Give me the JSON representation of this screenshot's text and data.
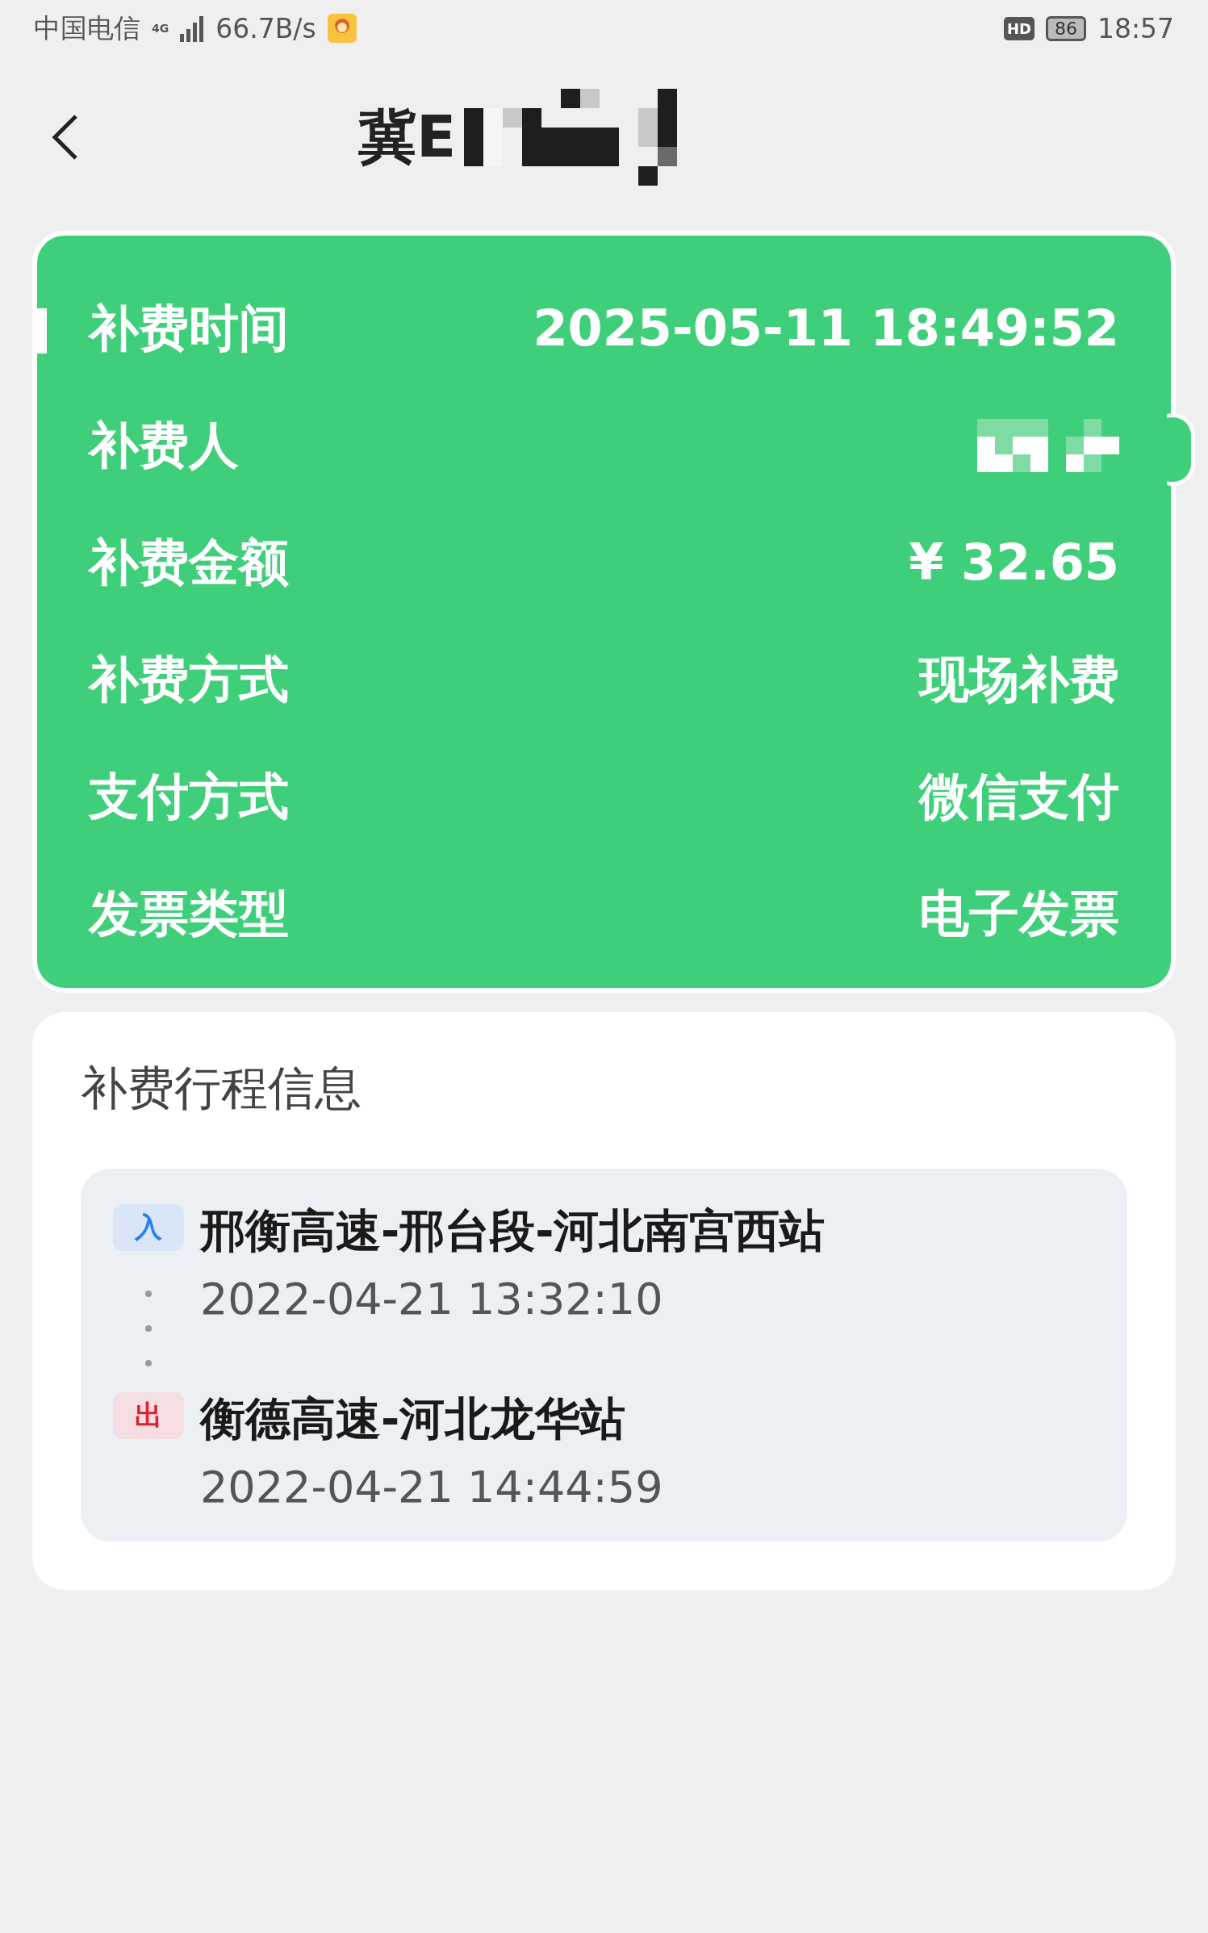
{
  "status_bar": {
    "carrier": "中国电信",
    "network": "4G",
    "speed": "66.7B/s",
    "hd": "HD",
    "battery": "86",
    "time": "18:57"
  },
  "header": {
    "title": "冀E",
    "title_redacted": true
  },
  "details": [
    {
      "label": "补费时间",
      "kind": "text",
      "value": "2025-05-11 18:49:52",
      "selected": true
    },
    {
      "label": "补费人",
      "kind": "redacted",
      "selected": false
    },
    {
      "label": "补费金额",
      "kind": "text",
      "value": "¥ 32.65",
      "selected": false
    },
    {
      "label": "补费方式",
      "kind": "text",
      "value": "现场补费",
      "selected": false
    },
    {
      "label": "支付方式",
      "kind": "text",
      "value": "微信支付",
      "selected": false
    },
    {
      "label": "发票类型",
      "kind": "text",
      "value": "电子发票",
      "selected": false
    }
  ],
  "trip": {
    "title": "补费行程信息",
    "stops": [
      {
        "kind": "entry",
        "badge": "入",
        "station": "邢衡高速-邢台段-河北南宫西站",
        "time": "2022-04-21 13:32:10"
      },
      {
        "kind": "exit",
        "badge": "出",
        "station": "衡德高速-河北龙华站",
        "time": "2022-04-21 14:44:59"
      }
    ]
  }
}
